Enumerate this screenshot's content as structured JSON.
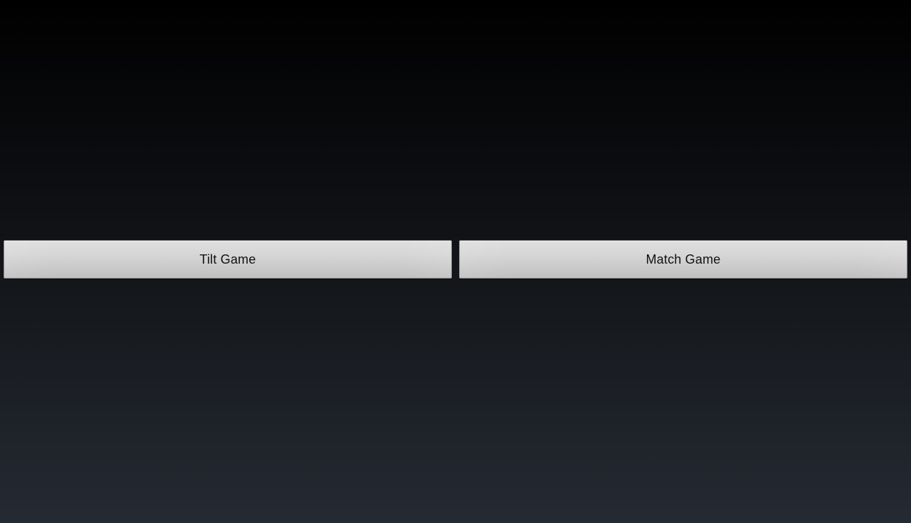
{
  "buttons": {
    "tilt_game": {
      "label": "Tilt Game"
    },
    "match_game": {
      "label": "Match Game"
    }
  },
  "colors": {
    "background_top": "#000000",
    "background_bottom": "#252a33",
    "button_face": "#d6d7d6",
    "button_text": "#111111"
  }
}
